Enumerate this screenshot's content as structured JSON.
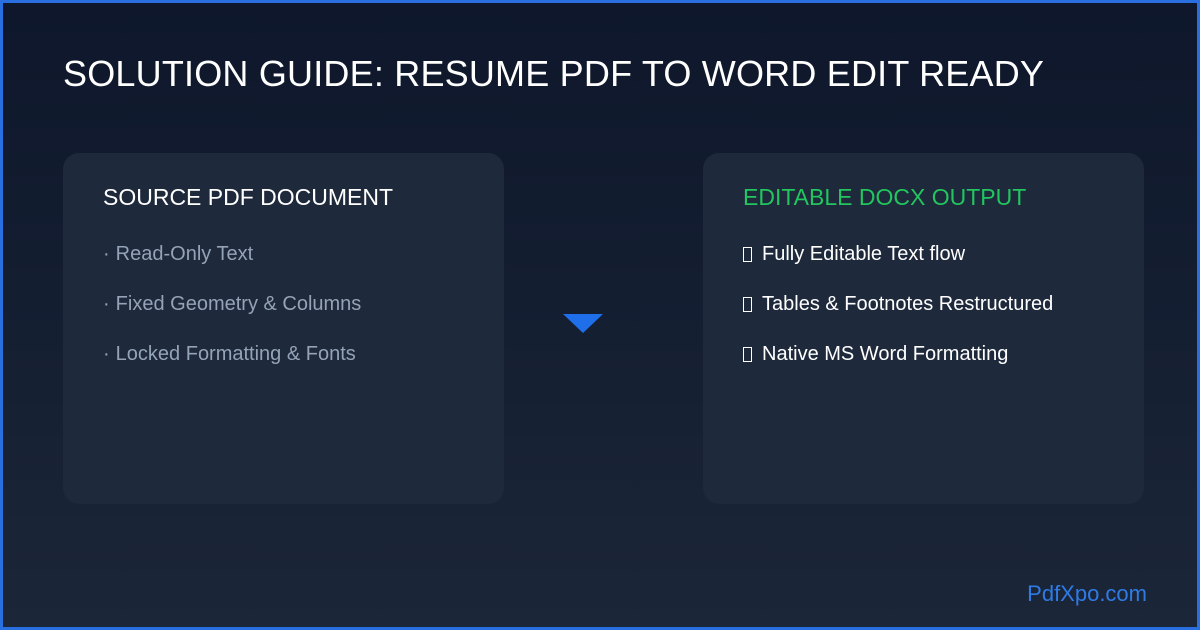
{
  "title": "SOLUTION GUIDE: RESUME PDF TO WORD EDIT READY",
  "source": {
    "heading": "SOURCE PDF DOCUMENT",
    "items": [
      {
        "marker": "·",
        "label": "Read-Only Text"
      },
      {
        "marker": "·",
        "label": "Fixed Geometry & Columns"
      },
      {
        "marker": "·",
        "label": "Locked Formatting & Fonts"
      }
    ]
  },
  "output": {
    "heading": "EDITABLE DOCX OUTPUT",
    "heading_color": "#22c55e",
    "items": [
      {
        "icon": "missing-glyph-box-icon",
        "label": "Fully Editable Text flow"
      },
      {
        "icon": "missing-glyph-box-icon",
        "label": "Tables & Footnotes Restructured"
      },
      {
        "icon": "missing-glyph-box-icon",
        "label": "Native MS Word Formatting"
      }
    ]
  },
  "arrow": {
    "icon": "down-arrow-icon",
    "color": "#1f6feb"
  },
  "brand": {
    "text": "PdfXpo.com",
    "color": "#2f7ae5"
  },
  "colors": {
    "border": "#2a6fe0",
    "card": "#1e293b",
    "muted_text": "#94a3b8"
  }
}
